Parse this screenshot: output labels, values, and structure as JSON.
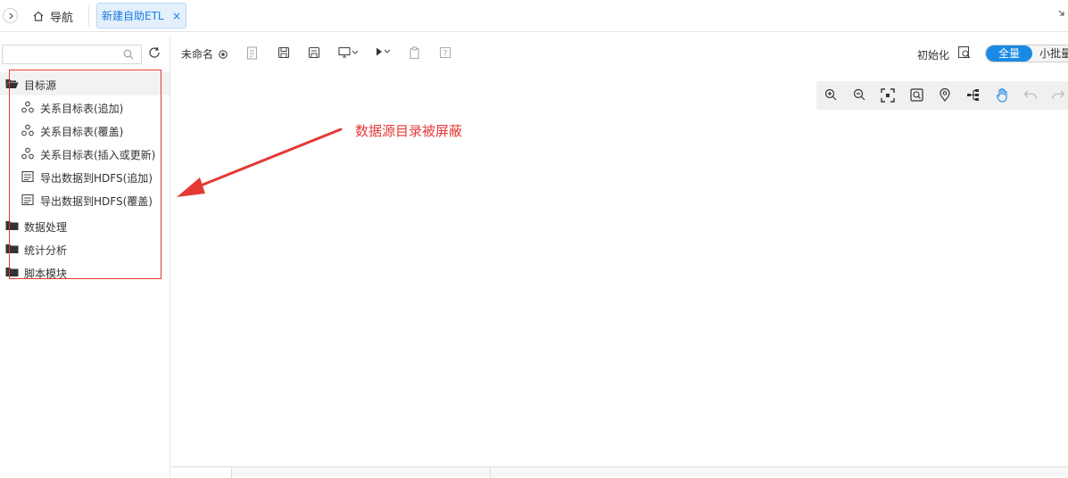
{
  "topbar": {
    "nav_label": "导航",
    "active_tab_label": "新建自助ETL",
    "close_glyph": "×"
  },
  "sidebar": {
    "search_placeholder": "",
    "tree": [
      {
        "type": "folder",
        "label": "目标源",
        "open": true
      },
      {
        "type": "leaf",
        "label": "关系目标表(追加)",
        "icon": "relation-icon"
      },
      {
        "type": "leaf",
        "label": "关系目标表(覆盖)",
        "icon": "relation-icon"
      },
      {
        "type": "leaf",
        "label": "关系目标表(插入或更新)",
        "icon": "relation-icon"
      },
      {
        "type": "leaf",
        "label": "导出数据到HDFS(追加)",
        "icon": "hdfs-icon"
      },
      {
        "type": "leaf",
        "label": "导出数据到HDFS(覆盖)",
        "icon": "hdfs-icon"
      },
      {
        "type": "folder",
        "label": "数据处理",
        "open": false
      },
      {
        "type": "folder",
        "label": "统计分析",
        "open": false
      },
      {
        "type": "folder",
        "label": "脚本模块",
        "open": false
      }
    ]
  },
  "toolbar": {
    "doc_name": "未命名",
    "init_label": "初始化",
    "mode_full": "全量",
    "mode_batch": "小批量"
  },
  "annotation": {
    "text": "数据源目录被屏蔽",
    "color": "#e53935"
  },
  "colors": {
    "accent": "#1a8ae5",
    "tab_bg": "#e3f0fc"
  }
}
